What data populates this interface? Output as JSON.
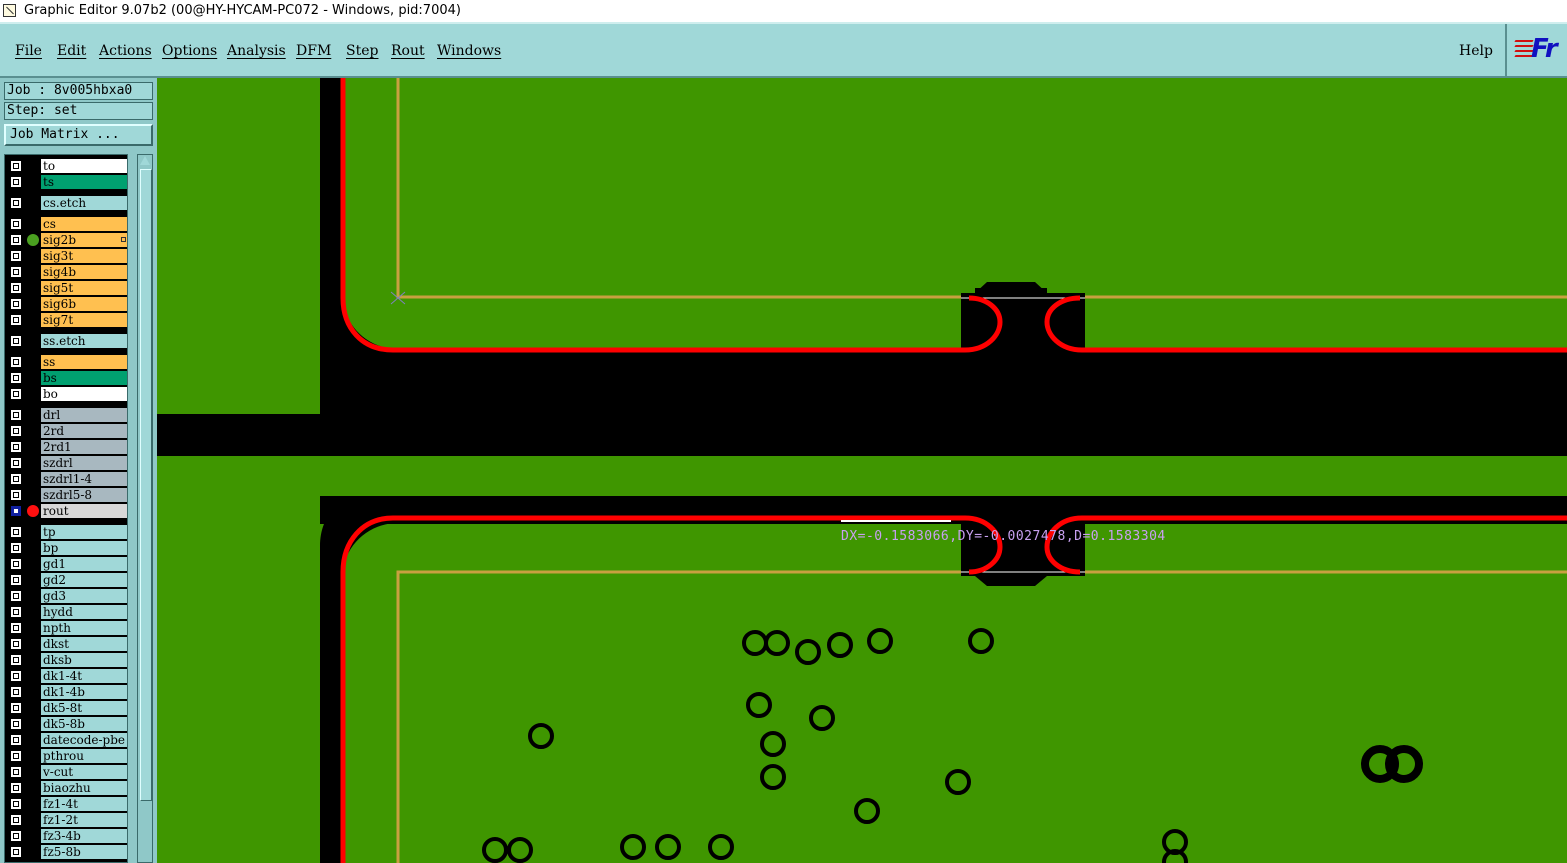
{
  "window": {
    "title": "Graphic Editor 9.07b2 (00@HY-HYCAM-PC072 - Windows, pid:7004)"
  },
  "menubar": {
    "items": [
      "File",
      "Edit",
      "Actions",
      "Options",
      "Analysis",
      "DFM",
      "Step",
      "Rout",
      "Windows"
    ],
    "help": "Help",
    "logo": "Fr"
  },
  "job": {
    "job_label": "Job : 8v005hbxa0",
    "step_label": "Step: set",
    "matrix_button": "Job Matrix ..."
  },
  "layers": [
    {
      "name": "to",
      "color": "#ffffff",
      "gap_before": false
    },
    {
      "name": "ts",
      "color": "#00a070",
      "gap_before": false
    },
    {
      "name": "cs.etch",
      "color": "#a0d8d8",
      "gap_before": true
    },
    {
      "name": "cs",
      "color": "#ffc050",
      "gap_before": true
    },
    {
      "name": "sig2b",
      "color": "#ffc050",
      "indicator": "#4aa020",
      "marker": true
    },
    {
      "name": "sig3t",
      "color": "#ffc050"
    },
    {
      "name": "sig4b",
      "color": "#ffc050"
    },
    {
      "name": "sig5t",
      "color": "#ffc050"
    },
    {
      "name": "sig6b",
      "color": "#ffc050"
    },
    {
      "name": "sig7t",
      "color": "#ffc050"
    },
    {
      "name": "ss.etch",
      "color": "#a0d8d8",
      "gap_before": true
    },
    {
      "name": "ss",
      "color": "#ffc050",
      "gap_before": true
    },
    {
      "name": "bs",
      "color": "#00a070"
    },
    {
      "name": "bo",
      "color": "#ffffff"
    },
    {
      "name": "drl",
      "color": "#a8b8c0",
      "gap_before": true
    },
    {
      "name": "2rd",
      "color": "#a8b8c0"
    },
    {
      "name": "2rd1",
      "color": "#a8b8c0"
    },
    {
      "name": "szdrl",
      "color": "#a8b8c0"
    },
    {
      "name": "szdrl1-4",
      "color": "#a8b8c0"
    },
    {
      "name": "szdrl5-8",
      "color": "#a8b8c0"
    },
    {
      "name": "rout",
      "color": "#d8d8d8",
      "indicator": "#ff1010",
      "selected": true
    },
    {
      "name": "tp",
      "color": "#a0d8d8",
      "gap_before": true
    },
    {
      "name": "bp",
      "color": "#a0d8d8"
    },
    {
      "name": "gd1",
      "color": "#a0d8d8"
    },
    {
      "name": "gd2",
      "color": "#a0d8d8"
    },
    {
      "name": "gd3",
      "color": "#a0d8d8"
    },
    {
      "name": "hydd",
      "color": "#a0d8d8"
    },
    {
      "name": "npth",
      "color": "#a0d8d8"
    },
    {
      "name": "dkst",
      "color": "#a0d8d8"
    },
    {
      "name": "dksb",
      "color": "#a0d8d8"
    },
    {
      "name": "dk1-4t",
      "color": "#a0d8d8"
    },
    {
      "name": "dk1-4b",
      "color": "#a0d8d8"
    },
    {
      "name": "dk5-8t",
      "color": "#a0d8d8"
    },
    {
      "name": "dk5-8b",
      "color": "#a0d8d8"
    },
    {
      "name": "datecode-pbe",
      "color": "#a0d8d8"
    },
    {
      "name": "pthrou",
      "color": "#a0d8d8"
    },
    {
      "name": "v-cut",
      "color": "#a0d8d8"
    },
    {
      "name": "biaozhu",
      "color": "#a0d8d8"
    },
    {
      "name": "fz1-4t",
      "color": "#a0d8d8"
    },
    {
      "name": "fz1-2t",
      "color": "#a0d8d8"
    },
    {
      "name": "fz3-4b",
      "color": "#a0d8d8"
    },
    {
      "name": "fz5-8b",
      "color": "#a0d8d8"
    }
  ],
  "canvas": {
    "measurement": "DX=-0.1583066,DY=-0.0027478,D=0.1583304",
    "colors": {
      "board": "#3f9600",
      "rout": "#ff0000",
      "outline": "#c8a040",
      "background": "#000000"
    }
  }
}
